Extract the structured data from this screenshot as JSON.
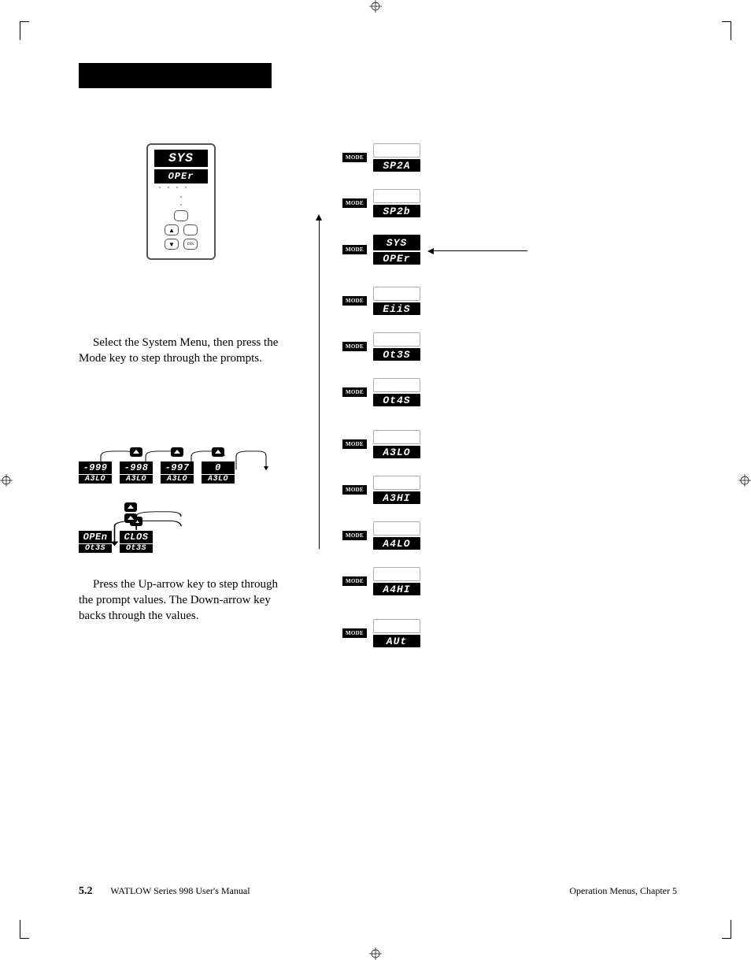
{
  "device": {
    "upper": "SYS",
    "lower": "OPEr"
  },
  "left_text_1": "Select the System Menu, then press the Mode key to step through the prompts.",
  "left_text_2": "Press the Up-arrow key to step through the prompt values. The Down-arrow key backs through the values.",
  "flow": {
    "mode_label": "MODE",
    "pre_header": [
      "SP2A",
      "SP2b"
    ],
    "header": {
      "upper": "SYS",
      "lower": "OPEr"
    },
    "items": [
      "EiiS",
      "Ot3S",
      "Ot4S",
      "A3LO",
      "A3HI",
      "A4LO",
      "A4HI",
      "AUt"
    ]
  },
  "step_diagram_1": {
    "cells": [
      {
        "top": "-999",
        "bot": "A3LO"
      },
      {
        "top": "-998",
        "bot": "A3LO"
      },
      {
        "top": "-997",
        "bot": "A3LO"
      },
      {
        "top": "0",
        "bot": "A3LO"
      }
    ]
  },
  "step_diagram_2": {
    "cells": [
      {
        "top": "OPEn",
        "bot": "Ot3S"
      },
      {
        "top": "CLOS",
        "bot": "Ot3S"
      }
    ]
  },
  "footer": {
    "page_number": "5.2",
    "manual": "WATLOW Series 998 User's Manual",
    "chapter": "Operation Menus, Chapter 5"
  }
}
